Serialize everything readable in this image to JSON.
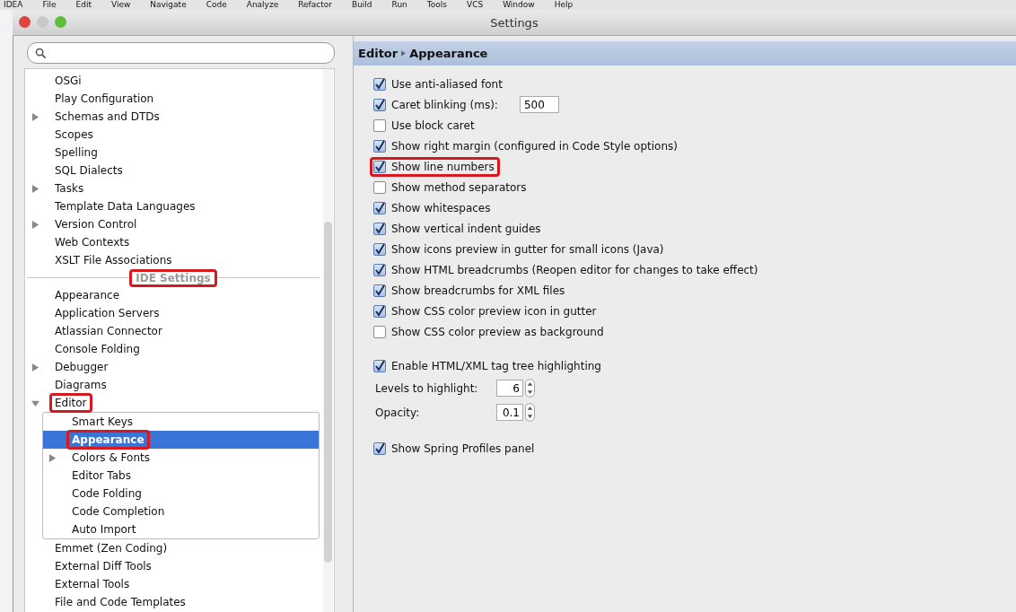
{
  "menu_bar": [
    "IDEA",
    "File",
    "Edit",
    "View",
    "Navigate",
    "Code",
    "Analyze",
    "Refactor",
    "Build",
    "Run",
    "Tools",
    "VCS",
    "Window",
    "Help"
  ],
  "window": {
    "title": "Settings"
  },
  "tree": {
    "project_items": [
      {
        "label": "OSGi",
        "selected": false,
        "marked": false
      },
      {
        "label": "Play Configuration",
        "selected": false,
        "marked": false
      },
      {
        "label": "Schemas and DTDs",
        "expanded": false,
        "selected": false,
        "marked": false
      },
      {
        "label": "Scopes",
        "selected": false,
        "marked": false
      },
      {
        "label": "Spelling",
        "selected": false,
        "marked": false
      },
      {
        "label": "SQL Dialects",
        "selected": false,
        "marked": false
      },
      {
        "label": "Tasks",
        "expanded": false,
        "selected": false,
        "marked": false
      },
      {
        "label": "Template Data Languages",
        "selected": false,
        "marked": false
      },
      {
        "label": "Version Control",
        "expanded": false,
        "selected": false,
        "marked": false
      },
      {
        "label": "Web Contexts",
        "selected": false,
        "marked": false
      },
      {
        "label": "XSLT File Associations",
        "selected": false,
        "marked": false
      }
    ],
    "section_label": {
      "text": "IDE Settings",
      "marked": true
    },
    "ide_items": [
      {
        "label": "Appearance",
        "selected": false,
        "marked": false
      },
      {
        "label": "Application Servers",
        "selected": false,
        "marked": false
      },
      {
        "label": "Atlassian Connector",
        "selected": false,
        "marked": false
      },
      {
        "label": "Console Folding",
        "selected": false,
        "marked": false
      },
      {
        "label": "Debugger",
        "expanded": false,
        "selected": false,
        "marked": false
      },
      {
        "label": "Diagrams",
        "selected": false,
        "marked": false
      },
      {
        "label": "Editor",
        "expanded": true,
        "selected": false,
        "marked": true,
        "children": [
          {
            "label": "Smart Keys",
            "selected": false,
            "marked": false
          },
          {
            "label": "Appearance",
            "selected": true,
            "marked": true
          },
          {
            "label": "Colors & Fonts",
            "expanded": false,
            "selected": false,
            "marked": false
          },
          {
            "label": "Editor Tabs",
            "selected": false,
            "marked": false
          },
          {
            "label": "Code Folding",
            "selected": false,
            "marked": false
          },
          {
            "label": "Code Completion",
            "selected": false,
            "marked": false
          },
          {
            "label": "Auto Import",
            "selected": false,
            "marked": false
          }
        ]
      },
      {
        "label": "Emmet (Zen Coding)",
        "selected": false,
        "marked": false
      },
      {
        "label": "External Diff Tools",
        "selected": false,
        "marked": false
      },
      {
        "label": "External Tools",
        "selected": false,
        "marked": false
      },
      {
        "label": "File and Code Templates",
        "selected": false,
        "marked": false
      }
    ]
  },
  "breadcrumb": [
    "Editor",
    "Appearance"
  ],
  "option_groups": [
    [
      {
        "kind": "checkbox",
        "label": "Use anti-aliased font",
        "checked": true,
        "marked": false
      },
      {
        "kind": "checkbox",
        "label": "Caret blinking (ms):",
        "checked": true,
        "marked": false,
        "value": "500"
      },
      {
        "kind": "checkbox",
        "label": "Use block caret",
        "checked": false,
        "marked": false
      },
      {
        "kind": "checkbox",
        "label": "Show right margin (configured in Code Style options)",
        "checked": true,
        "marked": false
      },
      {
        "kind": "checkbox",
        "label": "Show line numbers",
        "checked": true,
        "marked": true
      },
      {
        "kind": "checkbox",
        "label": "Show method separators",
        "checked": false,
        "marked": false
      },
      {
        "kind": "checkbox",
        "label": "Show whitespaces",
        "checked": true,
        "marked": false
      },
      {
        "kind": "checkbox",
        "label": "Show vertical indent guides",
        "checked": true,
        "marked": false
      },
      {
        "kind": "checkbox",
        "label": "Show icons preview in gutter for small icons (Java)",
        "checked": true,
        "marked": false
      },
      {
        "kind": "checkbox",
        "label": "Show HTML breadcrumbs (Reopen editor for changes to take effect)",
        "checked": true,
        "marked": false
      },
      {
        "kind": "checkbox",
        "label": "Show breadcrumbs for XML files",
        "checked": true,
        "marked": false
      },
      {
        "kind": "checkbox",
        "label": "Show CSS color preview icon in gutter",
        "checked": true,
        "marked": false
      },
      {
        "kind": "checkbox",
        "label": "Show CSS color preview as background",
        "checked": false,
        "marked": false
      }
    ],
    [
      {
        "kind": "checkbox",
        "label": "Enable HTML/XML tag tree highlighting",
        "checked": true,
        "marked": false
      },
      {
        "kind": "spinner",
        "label": "Levels to highlight:",
        "value": "6",
        "marked": false
      },
      {
        "kind": "spinner",
        "label": "Opacity:",
        "value": "0.1",
        "marked": false
      }
    ],
    [
      {
        "kind": "checkbox",
        "label": "Show Spring Profiles panel",
        "checked": true,
        "marked": false
      }
    ]
  ]
}
